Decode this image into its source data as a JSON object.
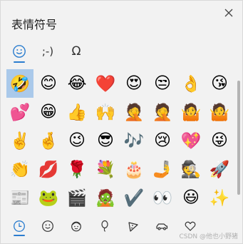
{
  "window": {
    "title": "表情符号"
  },
  "tabs": [
    {
      "label": "☺",
      "icon": "emoji-tab-icon",
      "active": true
    },
    {
      "label": ";-)",
      "icon": "kaomoji-tab-icon",
      "active": false
    },
    {
      "label": "Ω",
      "icon": "symbols-tab-icon",
      "active": false
    }
  ],
  "emojis": [
    "🤣",
    "😊",
    "😂",
    "❤️",
    "😍",
    "😒",
    "👌",
    "😘",
    "💕",
    "😁",
    "👍",
    "🙌",
    "🤦",
    "🤦",
    "🤷",
    "🤷",
    "✌️",
    "🤞",
    "😉",
    "😎",
    "🎶",
    "😢",
    "💖",
    "😜",
    "👏",
    "💋",
    "🌹",
    "💐",
    "🎂",
    "🤳",
    "🕵",
    "🚀",
    "📰",
    "🐸",
    "🎬",
    "🧟",
    "✔️",
    "👀",
    "😃",
    "✨"
  ],
  "categories": [
    {
      "icon": "recent-clock-icon",
      "active": true
    },
    {
      "icon": "smiley-category-icon",
      "active": false
    },
    {
      "icon": "people-category-icon",
      "active": false
    },
    {
      "icon": "celebration-balloon-icon",
      "active": false
    },
    {
      "icon": "food-pizza-icon",
      "active": false
    },
    {
      "icon": "travel-car-icon",
      "active": false
    },
    {
      "icon": "heart-symbols-icon",
      "active": false
    }
  ],
  "watermark": "CSDN @他也小野猪",
  "colors": {
    "accent": "#2b7dcf",
    "selected": "#aac9ea",
    "background": "#f2f2f2"
  }
}
